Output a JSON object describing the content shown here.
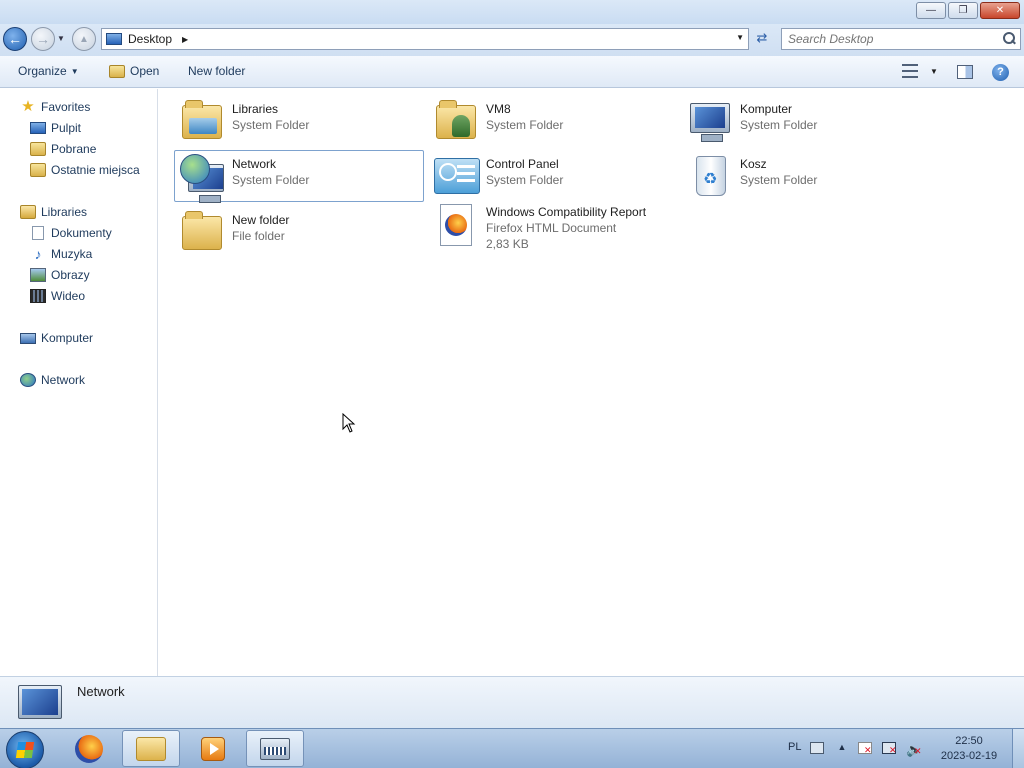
{
  "window": {
    "controls": {
      "minimize": "—",
      "restore": "❐",
      "close": "✕"
    }
  },
  "address": {
    "location": "Desktop",
    "search_placeholder": "Search Desktop"
  },
  "toolbar": {
    "organize": "Organize",
    "open": "Open",
    "new_folder": "New folder"
  },
  "nav": {
    "favorites": {
      "label": "Favorites",
      "items": [
        "Pulpit",
        "Pobrane",
        "Ostatnie miejsca"
      ]
    },
    "libraries": {
      "label": "Libraries",
      "items": [
        "Dokumenty",
        "Muzyka",
        "Obrazy",
        "Wideo"
      ]
    },
    "computer": "Komputer",
    "network": "Network"
  },
  "items": [
    {
      "name": "Libraries",
      "type": "System Folder",
      "icon": "libraries-icon"
    },
    {
      "name": "VM8",
      "type": "System Folder",
      "icon": "user-folder-icon"
    },
    {
      "name": "Komputer",
      "type": "System Folder",
      "icon": "computer-icon"
    },
    {
      "name": "Network",
      "type": "System Folder",
      "icon": "network-icon"
    },
    {
      "name": "Control Panel",
      "type": "System Folder",
      "icon": "control-panel-icon"
    },
    {
      "name": "Kosz",
      "type": "System Folder",
      "icon": "recycle-bin-icon"
    },
    {
      "name": "New folder",
      "type": "File folder",
      "icon": "folder-icon"
    },
    {
      "name": "Windows Compatibility Report",
      "type": "Firefox HTML Document",
      "size": "2,83 KB",
      "icon": "firefox-document-icon"
    }
  ],
  "details": {
    "name": "Network"
  },
  "taskbar": {
    "language": "PL",
    "time": "22:50",
    "date": "2023-02-19"
  }
}
